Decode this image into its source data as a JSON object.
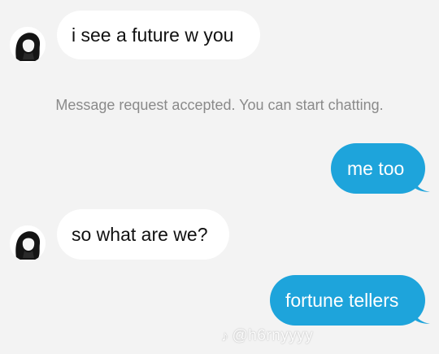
{
  "messages": [
    {
      "direction": "incoming",
      "text": "i see a future w you"
    },
    {
      "direction": "system",
      "text": "Message request accepted. You can start chatting."
    },
    {
      "direction": "outgoing",
      "text": "me too"
    },
    {
      "direction": "incoming",
      "text": "so what are we?"
    },
    {
      "direction": "outgoing",
      "text": "fortune tellers"
    }
  ],
  "watermark": {
    "icon": "tiktok-logo-icon",
    "handle": "@h6rnyyyy"
  },
  "colors": {
    "background": "#f3f3f3",
    "incoming_bubble": "#ffffff",
    "outgoing_bubble": "#1ea4db",
    "system_text": "#8a8a8a"
  }
}
